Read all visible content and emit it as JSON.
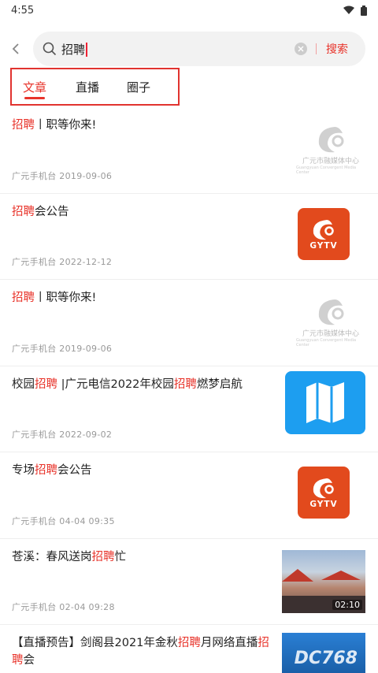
{
  "status_bar": {
    "time": "4:55"
  },
  "search": {
    "query": "招聘",
    "button_label": "搜索"
  },
  "tabs": [
    {
      "label": "文章",
      "active": true
    },
    {
      "label": "直播"
    },
    {
      "label": "圈子"
    }
  ],
  "items": [
    {
      "title_parts": [
        "招聘",
        "丨职等你来!"
      ],
      "meta": "广元手机台   2019-09-06",
      "thumb": "gy-logo"
    },
    {
      "title_parts": [
        "招聘",
        "会公告"
      ],
      "meta": "广元手机台   2022-12-12",
      "thumb": "gytv"
    },
    {
      "title_parts": [
        "招聘",
        "丨职等你来!"
      ],
      "meta": "广元手机台   2019-09-06",
      "thumb": "gy-logo"
    },
    {
      "title_parts": [
        "校园",
        "招聘",
        " |广元电信2022年校园",
        "招聘",
        "燃梦启航"
      ],
      "meta": "广元手机台   2022-09-02",
      "thumb": "map"
    },
    {
      "title_parts": [
        "专场",
        "招聘",
        "会公告"
      ],
      "meta": "广元手机台   04-04 09:35",
      "thumb": "gytv"
    },
    {
      "title_parts": [
        "苍溪：春风送岗",
        "招聘",
        "忙"
      ],
      "meta": "广元手机台   02-04 09:28",
      "thumb": "video",
      "duration": "02:10"
    },
    {
      "title_parts": [
        "【直播预告】剑阁县2021年金秋",
        "招聘",
        "月网络直播",
        "招聘",
        "会"
      ],
      "meta": "",
      "thumb": "banner",
      "watermark": "DC768"
    }
  ],
  "logo_text": {
    "gy_cn": "广元市融媒体中心",
    "gy_en": "Guangyuan Convergent Media Center",
    "gytv": "GYTV"
  },
  "colors": {
    "accent": "#e8332a",
    "highlight_box": "#e1332f"
  }
}
